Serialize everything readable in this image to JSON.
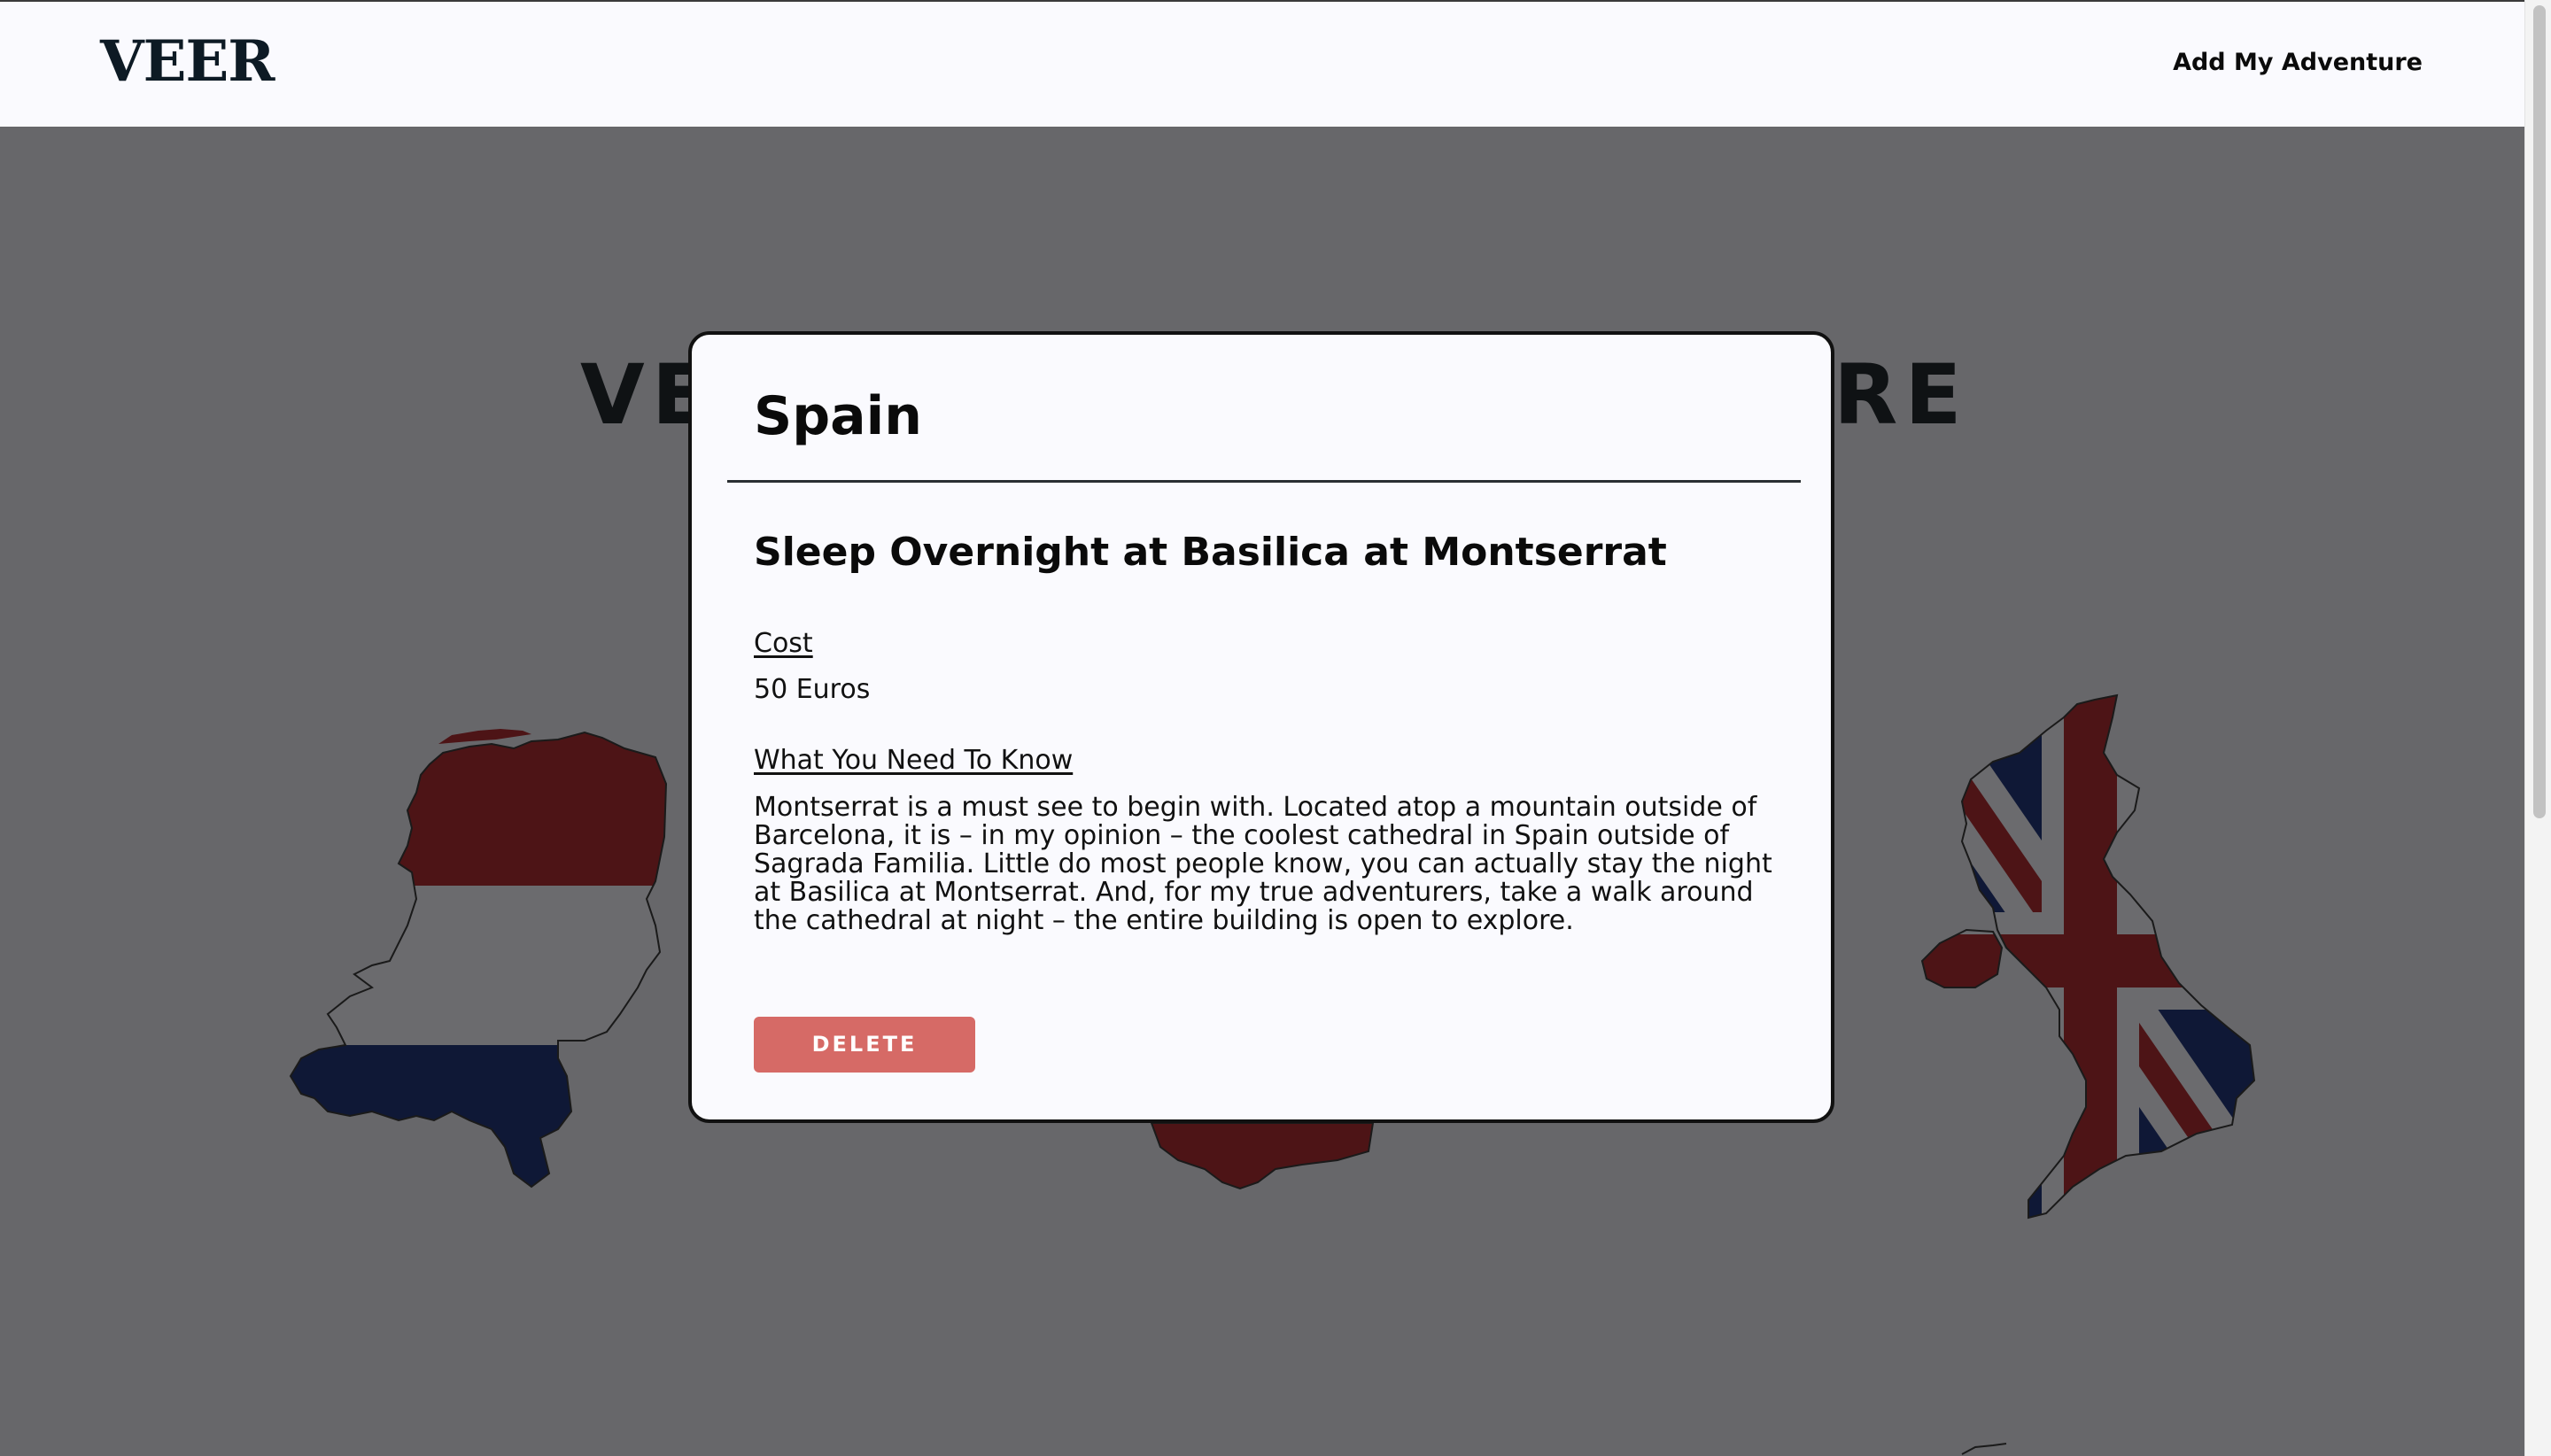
{
  "navbar": {
    "brand": "VEER",
    "add_link": "Add My Adventure"
  },
  "background": {
    "heading_left": "VE",
    "heading_right": "RE",
    "maps": [
      "netherlands-map",
      "spain-map",
      "united-kingdom-map"
    ],
    "colors": {
      "red": "#4d1416",
      "blue": "#0f1836",
      "overlay": "#67676a"
    }
  },
  "modal": {
    "country": "Spain",
    "adventure_title": "Sleep Overnight at Basilica at Montserrat",
    "cost_label": "Cost",
    "cost_value": "50 Euros",
    "know_label": "What You Need To Know",
    "description": "Montserrat is a must see to begin with. Located atop a mountain outside of Barcelona, it is – in my opinion – the coolest cathedral in Spain outside of Sagrada Familia. Little do most people know, you can actually stay the night at Basilica at Montserrat. And, for my true adventurers, take a walk around the cathedral at night – the entire building is open to explore.",
    "delete_label": "DELETE",
    "delete_color": "#d66a66"
  }
}
